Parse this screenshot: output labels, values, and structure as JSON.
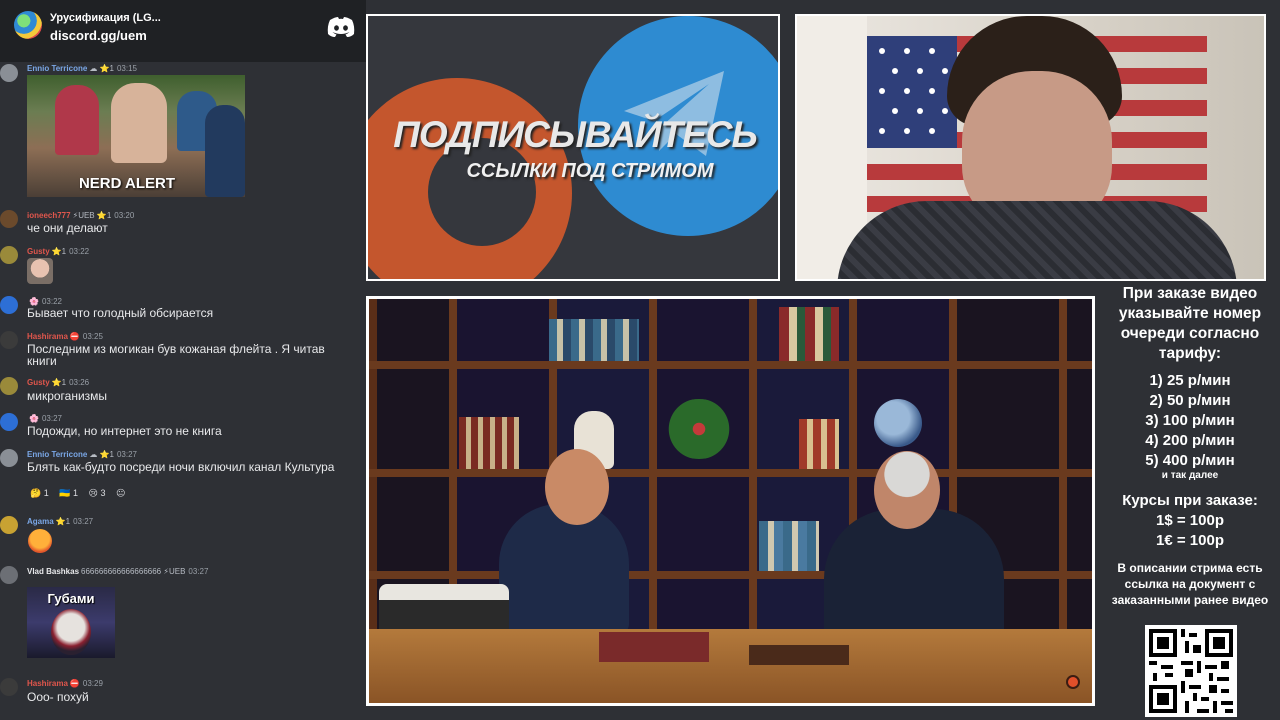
{
  "server": {
    "name": "Урусификация (LG...",
    "invite": "discord.gg/uem",
    "discord_icon": "discord-logo-icon"
  },
  "chat": {
    "meme_caption": "NERD ALERT",
    "messages": [
      {
        "user": "Ennio Terricone",
        "user_color": "#7aa7e6",
        "badges": "☁ ⭐1",
        "time": "03:15",
        "text": ""
      },
      {
        "user": "ioneech777",
        "user_color": "#e0564c",
        "badges": "⚡UEB ⭐1",
        "time": "03:20",
        "text": "че они делают"
      },
      {
        "user": "Gusty",
        "user_color": "#e0564c",
        "badges": "⭐1",
        "time": "03:22",
        "text": ""
      },
      {
        "user": "",
        "user_color": "#b7bcc4",
        "badges": "🌸",
        "time": "03:22",
        "text": "Бывает что голодный обсирается"
      },
      {
        "user": "Hashirama",
        "user_color": "#e0564c",
        "badges": "⛔",
        "time": "03:25",
        "text": "Последним из могикан був кожаная флейта . Я читав книги"
      },
      {
        "user": "Gusty",
        "user_color": "#e0564c",
        "badges": "⭐1",
        "time": "03:26",
        "text": "микроганизмы"
      },
      {
        "user": "",
        "user_color": "#b7bcc4",
        "badges": "🌸",
        "time": "03:27",
        "text": "Подожди, но интернет это не книга"
      },
      {
        "user": "Ennio Terricone",
        "user_color": "#7aa7e6",
        "badges": "☁ ⭐1",
        "time": "03:27",
        "text": "Блять как-будто посреди ночи включил канал Культура"
      },
      {
        "user": "Agama",
        "user_color": "#7aa7e6",
        "badges": "⭐1",
        "time": "03:27",
        "text": ""
      },
      {
        "user": "Vlad Bashkas",
        "user_color": "#b7bcc4",
        "badges": "666666666666666666 ⚡UEB",
        "time": "03:27",
        "text": ""
      },
      {
        "user": "Hashirama",
        "user_color": "#e0564c",
        "badges": "⛔",
        "time": "03:29",
        "text": "Ооо- похуй"
      }
    ],
    "reactions": [
      {
        "icon": "🤔",
        "count": "1"
      },
      {
        "icon": "🇺🇦",
        "count": "1"
      },
      {
        "icon": "😢",
        "count": "3"
      },
      {
        "icon": "😐",
        "count": ""
      }
    ],
    "sticker_caption": "Губами"
  },
  "banner": {
    "title": "ПОДПИСЫВАЙТЕСЬ",
    "subtitle": "ССЫЛКИ ПОД СТРИМОМ"
  },
  "info": {
    "order_text": "При заказе видео указывайте номер очереди согласно тарифу:",
    "tariffs": [
      "1) 25 р/мин",
      "2) 50 р/мин",
      "3) 100 р/мин",
      "4) 200 р/мин",
      "5) 400 р/мин"
    ],
    "etc": "и так далее",
    "rates_title": "Курсы при заказе:",
    "rates": [
      "1$ = 100р",
      "1€ = 100р"
    ],
    "doc_note": "В описании стрима есть ссылка на документ с заказанными ранее видео"
  }
}
